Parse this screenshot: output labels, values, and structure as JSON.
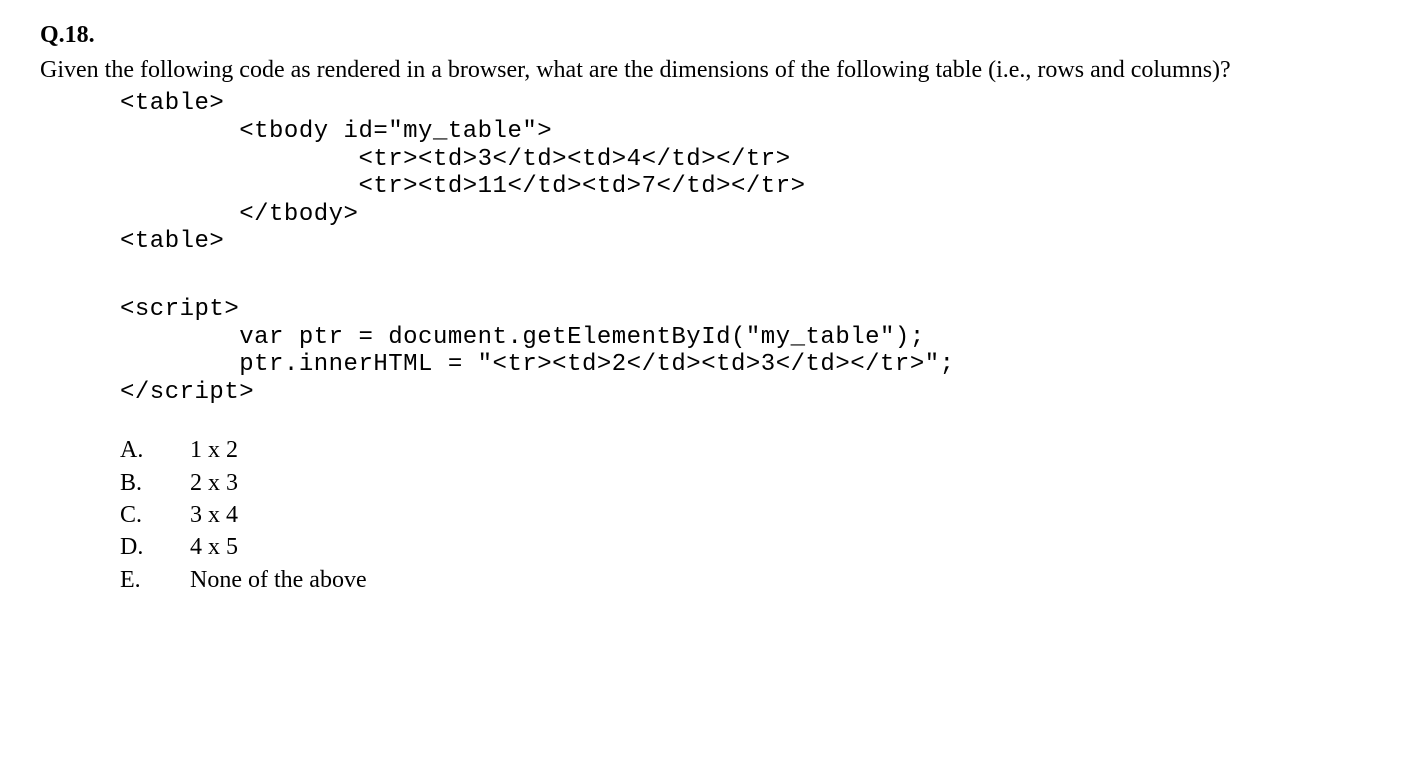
{
  "question": {
    "number": "Q.18.",
    "prompt": "Given the following code as rendered in a browser, what are the dimensions of the following table (i.e., rows and columns)?",
    "code1": "<table>\n        <tbody id=\"my_table\">\n                <tr><td>3</td><td>4</td></tr>\n                <tr><td>11</td><td>7</td></tr>\n        </tbody>\n<table>",
    "code2": "<script>\n        var ptr = document.getElementById(\"my_table\");\n        ptr.innerHTML = \"<tr><td>2</td><td>3</td></tr>\";\n</script>",
    "options": [
      {
        "letter": "A.",
        "text": "1 x 2"
      },
      {
        "letter": "B.",
        "text": "2 x 3"
      },
      {
        "letter": "C.",
        "text": "3 x 4"
      },
      {
        "letter": "D.",
        "text": "4 x 5"
      },
      {
        "letter": "E.",
        "text": "None of the above"
      }
    ]
  }
}
